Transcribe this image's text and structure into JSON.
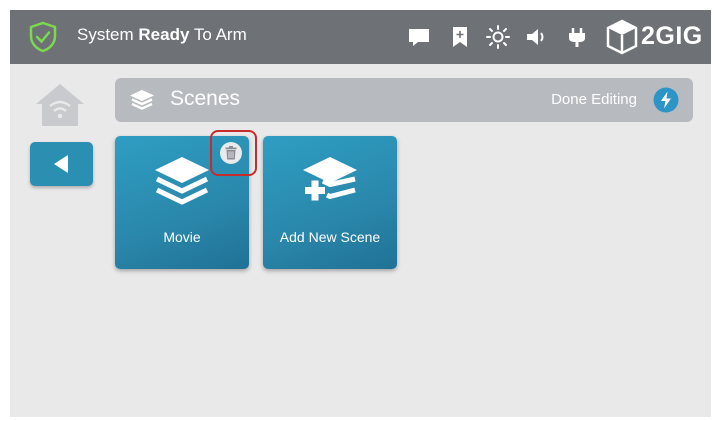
{
  "status": {
    "prefix": "System ",
    "emphasis": "Ready",
    "suffix": " To Arm"
  },
  "brand": {
    "name": "2GIG"
  },
  "toolbar_icons": [
    "message-icon",
    "bookmark-icon",
    "brightness-icon",
    "volume-icon",
    "power-plug-icon"
  ],
  "header": {
    "title": "Scenes",
    "done_label": "Done Editing"
  },
  "tiles": [
    {
      "label": "Movie"
    },
    {
      "label": "Add New Scene"
    }
  ],
  "colors": {
    "topbar": "#6e7176",
    "tile": "#2a87ab",
    "highlight": "#c62c2c",
    "shield": "#7bd84f"
  }
}
